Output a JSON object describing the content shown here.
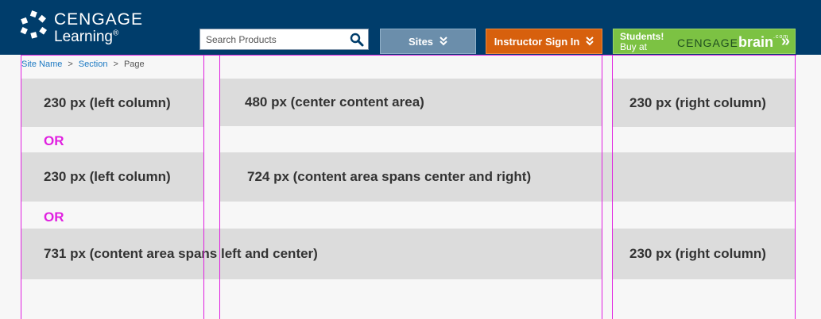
{
  "header": {
    "logo_line1": "CENGAGE",
    "logo_line2": "Learning",
    "logo_trademark": "®",
    "search": {
      "placeholder": "Search Products"
    },
    "sites_label": "Sites",
    "instructor_label": "Instructor Sign In",
    "students_line1": "Students!",
    "students_line2": "Buy at",
    "brand_cengage": "CENGAGE",
    "brand_brain": "brain",
    "brand_com": ".com",
    "brand_arrows": "»",
    "colors": {
      "header_bg": "#003d6b",
      "sites": "#6b8eab",
      "instructor": "#d7600d",
      "students": "#7cc243",
      "guides": "#e020e0"
    }
  },
  "breadcrumb": {
    "site_name": "Site Name",
    "section": "Section",
    "page": "Page",
    "separator": ">"
  },
  "layouts": [
    {
      "left": "230 px (left column)",
      "center": "480 px (center content area)",
      "right": "230 px (right column)"
    },
    {
      "left": "230 px (left column)",
      "wide": "724 px (content area spans center and right)"
    },
    {
      "wide": "731 px (content area spans left and center)",
      "right": "230 px (right column)"
    }
  ],
  "or_label": "OR"
}
